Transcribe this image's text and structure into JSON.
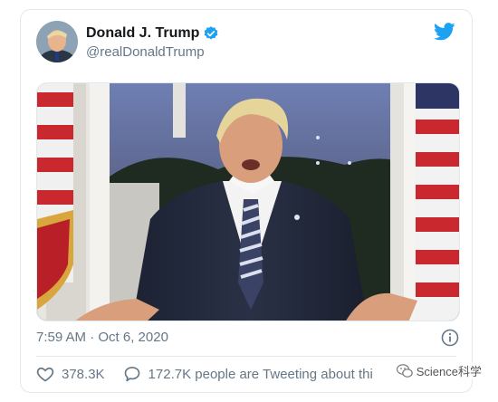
{
  "tweet": {
    "display_name": "Donald J. Trump",
    "handle": "@realDonaldTrump",
    "timestamp": "7:59 AM · Oct 6, 2020",
    "likes": "378.3K",
    "tweeting_text": "172.7K people are Tweeting about thi"
  },
  "watermark": {
    "text": "Science科学"
  },
  "colors": {
    "twitter_blue": "#1da1f2",
    "secondary_text": "#657786",
    "border": "#e1e8ed"
  },
  "icons": [
    "verified-badge-icon",
    "twitter-bird-icon",
    "info-icon",
    "heart-icon",
    "speech-bubble-icon",
    "wechat-icon"
  ]
}
